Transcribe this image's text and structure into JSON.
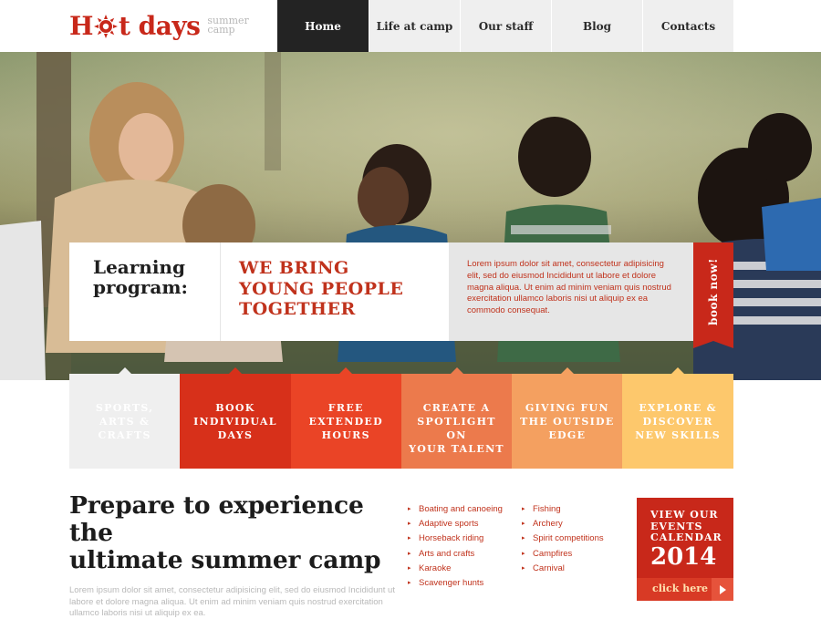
{
  "logo": {
    "text_before": "H",
    "text_after": "t days",
    "sub_line1": "summer",
    "sub_line2": "camp"
  },
  "nav": [
    {
      "label": "Home",
      "active": true
    },
    {
      "label": "Life at camp",
      "active": false
    },
    {
      "label": "Our staff",
      "active": false
    },
    {
      "label": "Blog",
      "active": false
    },
    {
      "label": "Contacts",
      "active": false
    }
  ],
  "slider": {
    "dots": 3,
    "active_dot": 2
  },
  "banner": {
    "program_line1": "Learning",
    "program_line2": "program:",
    "headline_line1": "WE BRING",
    "headline_line2": "YOUNG PEOPLE",
    "headline_line3": "TOGETHER",
    "description": "Lorem ipsum dolor sit amet, consectetur adipisicing elit, sed do eiusmod Incididunt ut labore et dolore magna aliqua. Ut enim ad minim veniam quis nostrud exercitation ullamco laboris nisi ut aliquip ex ea commodo consequat.",
    "book_label": "book now!"
  },
  "tiles": [
    {
      "line1": "SPORTS,",
      "line2": "ARTS &",
      "line3": "CRAFTS",
      "bg": "#efefef",
      "fg": "#c0321c"
    },
    {
      "line1": "BOOK",
      "line2": "INDIVIDUAL",
      "line3": "DAYS",
      "bg": "#d7301a",
      "fg": "#ffffff"
    },
    {
      "line1": "FREE",
      "line2": "EXTENDED",
      "line3": "HOURS",
      "bg": "#ea4426",
      "fg": "#ffffff"
    },
    {
      "line1": "CREATE A",
      "line2": "SPOTLIGHT ON",
      "line3": "YOUR TALENT",
      "bg": "#ec7a4c",
      "fg": "#ffffff"
    },
    {
      "line1": "GIVING FUN",
      "line2": "THE OUTSIDE",
      "line3": "EDGE",
      "bg": "#f4a060",
      "fg": "#ffffff"
    },
    {
      "line1": "EXPLORE &",
      "line2": "DISCOVER",
      "line3": "NEW SKILLS",
      "bg": "#fdc86c",
      "fg": "#ffffff"
    }
  ],
  "prepare": {
    "title_line1": "Prepare to experience the",
    "title_line2": "ultimate summer camp",
    "text": "Lorem ipsum dolor sit amet, consectetur adipisicing elit, sed do eiusmod Incididunt ut labore et dolore magna aliqua. Ut enim ad minim veniam quis nostrud exercitation ullamco laboris nisi ut aliquip ex ea."
  },
  "activities_col1": [
    "Boating and canoeing",
    "Adaptive sports",
    "Horseback riding",
    "Arts and crafts",
    "Karaoke",
    "Scavenger hunts"
  ],
  "activities_col2": [
    "Fishing",
    "Archery",
    "Spirit competitions",
    "Campfires",
    "Carnival"
  ],
  "events": {
    "line1": "VIEW OUR",
    "line2": "EVENTS",
    "line3": "CALENDAR",
    "year": "2014",
    "click_label": "click here"
  },
  "colors": {
    "brand_red": "#c8281a",
    "dark_nav": "#232323",
    "light_gray": "#efefef"
  }
}
